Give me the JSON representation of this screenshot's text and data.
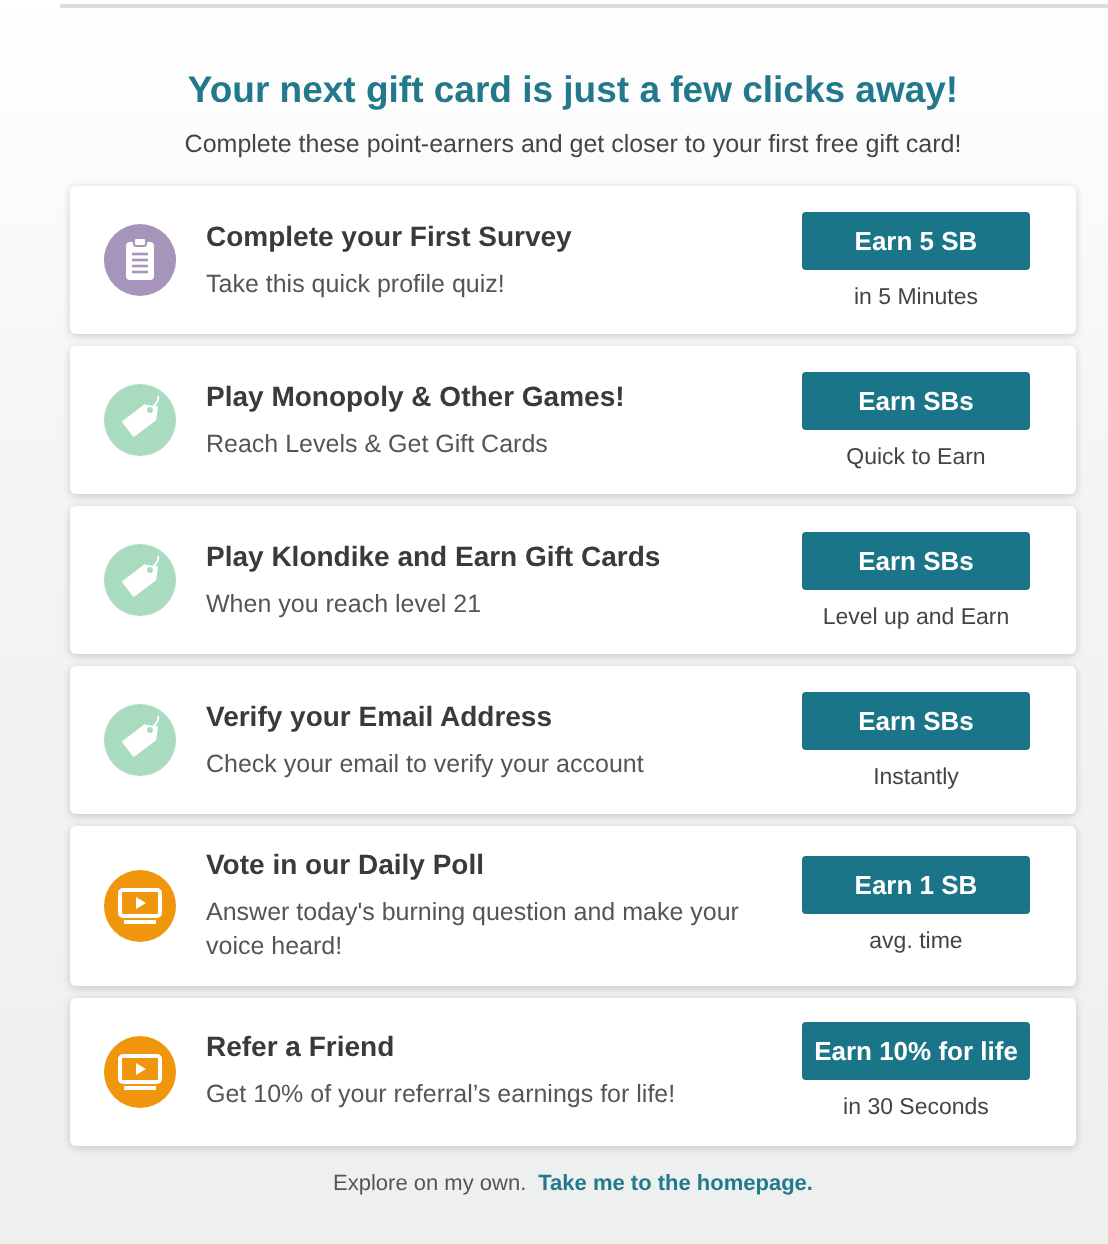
{
  "heading": "Your next gift card is just a few clicks away!",
  "subheading": "Complete these point-earners and get closer to your first free gift card!",
  "offers": [
    {
      "kind": "survey",
      "title": "Complete your First Survey",
      "description": "Take this quick profile quiz!",
      "button": "Earn 5 SB",
      "note": "in 5 Minutes"
    },
    {
      "kind": "game",
      "title": "Play Monopoly & Other Games!",
      "description": "Reach Levels & Get Gift Cards",
      "button": "Earn SBs",
      "note": "Quick to Earn"
    },
    {
      "kind": "game",
      "title": "Play Klondike and Earn Gift Cards",
      "description": "When you reach level 21",
      "button": "Earn SBs",
      "note": "Level up and Earn"
    },
    {
      "kind": "task",
      "title": "Verify your Email Address",
      "description": "Check your email to verify your account",
      "button": "Earn SBs",
      "note": "Instantly"
    },
    {
      "kind": "poll",
      "title": "Vote in our Daily Poll",
      "description": "Answer today's burning question and make your voice heard!",
      "button": "Earn 1 SB",
      "note": "avg. time"
    },
    {
      "kind": "referral",
      "title": "Refer a Friend",
      "description": "Get 10% of your referral’s earnings for life!",
      "button": "Earn 10% for life",
      "note": "in 30 Seconds"
    }
  ],
  "footer": {
    "text": "Explore on my own.",
    "link": "Take me to the homepage."
  }
}
